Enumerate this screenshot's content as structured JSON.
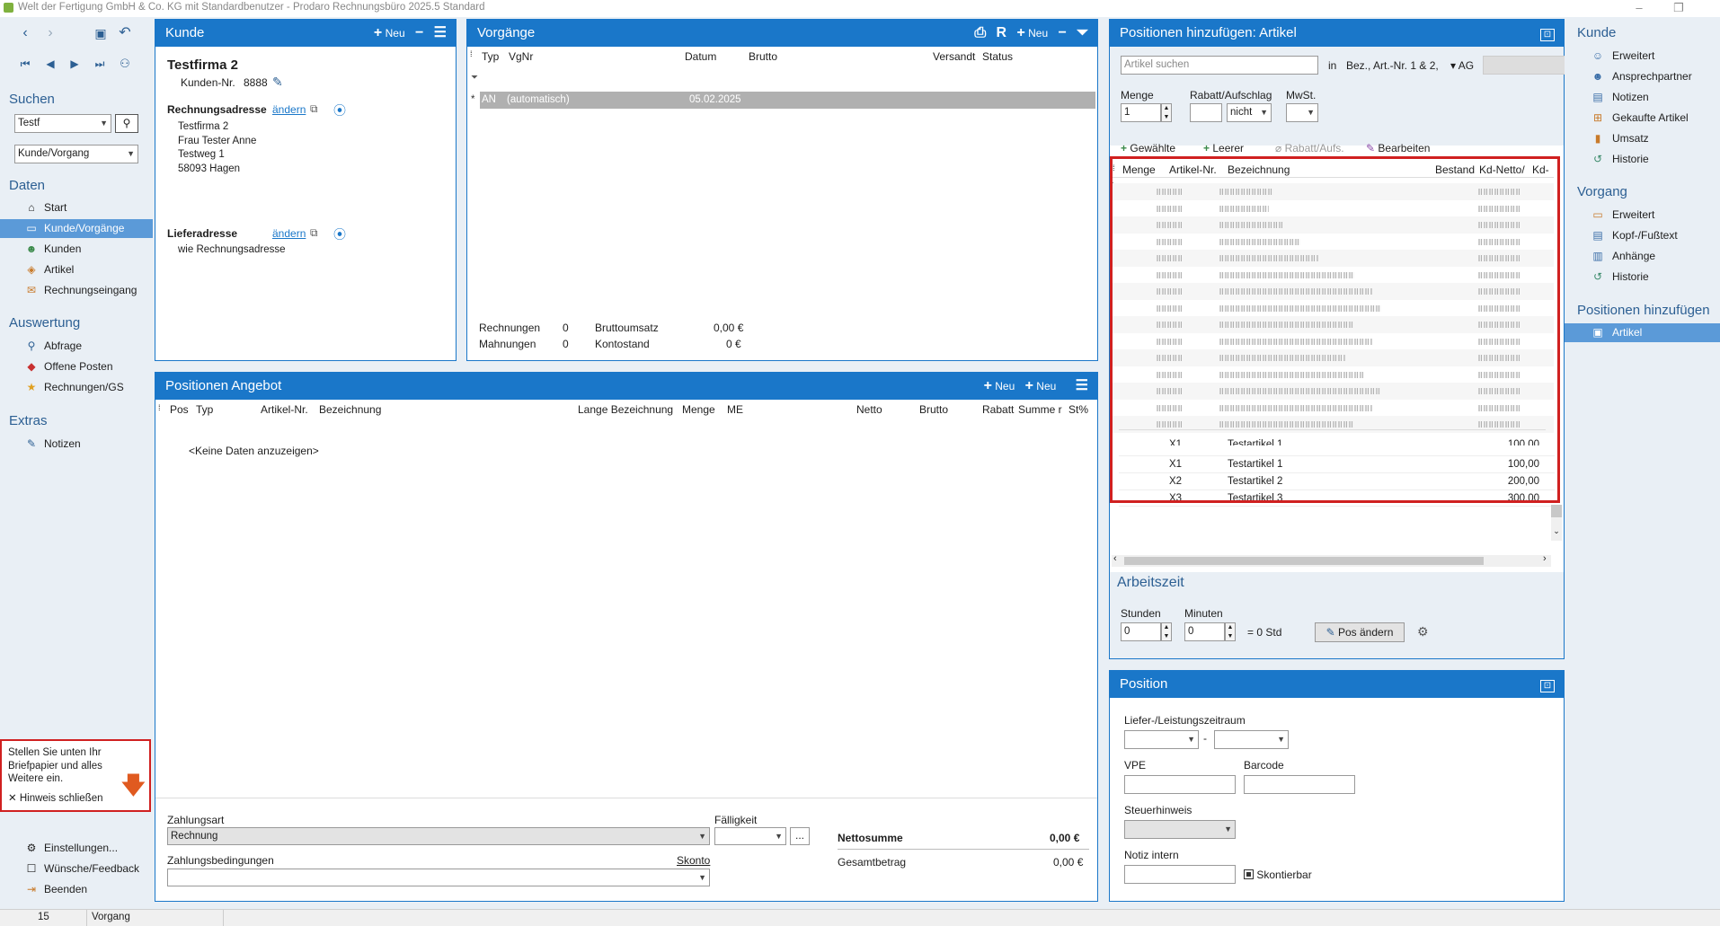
{
  "window": {
    "title": "Welt der Fertigung GmbH & Co. KG mit Standardbenutzer  -  Prodaro Rechnungsbüro 2025.5 Standard"
  },
  "sidebar": {
    "search_title": "Suchen",
    "search_value": "Testf",
    "search_mode": "Kunde/Vorgang",
    "daten_title": "Daten",
    "daten_items": [
      "Start",
      "Kunde/Vorgänge",
      "Kunden",
      "Artikel",
      "Rechnungseingang"
    ],
    "auswertung_title": "Auswertung",
    "auswertung_items": [
      "Abfrage",
      "Offene Posten",
      "Rechnungen/GS"
    ],
    "extras_title": "Extras",
    "extras_items": [
      "Notizen"
    ],
    "hint_text": "Stellen Sie unten Ihr Briefpapier und alles Weitere ein.",
    "hint_close": "Hinweis schließen",
    "bottom_items": [
      "Einstellungen...",
      "Wünsche/Feedback",
      "Beenden"
    ]
  },
  "kunde": {
    "title": "Kunde",
    "new_label": "Neu",
    "name": "Testfirma 2",
    "kunden_nr_label": "Kunden-Nr.",
    "kunden_nr": "8888",
    "rechnungsadresse_label": "Rechnungsadresse",
    "aendern": "ändern",
    "address": [
      "Testfirma 2",
      "Frau Tester Anne",
      "Testweg 1",
      "58093 Hagen"
    ],
    "lieferadresse_label": "Lieferadresse",
    "liefer_text": "wie Rechnungsadresse"
  },
  "vorgaenge": {
    "title": "Vorgänge",
    "new_label": "Neu",
    "r_label": "R",
    "columns": [
      "Typ",
      "VgNr",
      "Datum",
      "Brutto",
      "Versandt",
      "Status"
    ],
    "row": {
      "typ": "AN",
      "vgnr": "(automatisch)",
      "datum": "05.02.2025"
    },
    "rechnungen_label": "Rechnungen",
    "rechnungen": "0",
    "mahnungen_label": "Mahnungen",
    "mahnungen": "0",
    "bruttoumsatz_label": "Bruttoumsatz",
    "bruttoumsatz": "0,00 €",
    "kontostand_label": "Kontostand",
    "kontostand": "0 €"
  },
  "angebot": {
    "title": "Positionen Angebot",
    "new1": "Neu",
    "new2": "Neu",
    "columns": [
      "Pos",
      "Typ",
      "Artikel-Nr.",
      "Bezeichnung",
      "Lange Bezeichnung",
      "Menge",
      "ME",
      "Netto",
      "Brutto",
      "Rabatt",
      "Summe r",
      "St%"
    ],
    "empty": "<Keine Daten anzuzeigen>",
    "zahlungsart_label": "Zahlungsart",
    "zahlungsart": "Rechnung",
    "faelligkeit_label": "Fälligkeit",
    "zahlungsbed_label": "Zahlungsbedingungen",
    "skonto": "Skonto",
    "nettosumme_label": "Nettosumme",
    "nettosumme": "0,00  €",
    "gesamt_label": "Gesamtbetrag",
    "gesamt": "0,00  €"
  },
  "artikel": {
    "title": "Positionen hinzufügen: Artikel",
    "search_placeholder": "Artikel suchen",
    "in_label": "in",
    "in_value": "Bez., Art.-Nr. 1 & 2,",
    "ag_label": "AG",
    "menge_label": "Menge",
    "menge": "1",
    "rabatt_label": "Rabatt/Aufschlag",
    "rabatt_mode": "nicht",
    "mwst_label": "MwSt.",
    "btn_gewaehlte": "Gewählte",
    "btn_leerer": "Leerer",
    "btn_rabatt": "Rabatt/Aufs.",
    "btn_bearbeiten": "Bearbeiten",
    "columns": [
      "Menge",
      "Artikel-Nr.",
      "Bezeichnung",
      "Bestand",
      "Kd-Netto/",
      "Kd-"
    ],
    "rows": [
      {
        "nr": "X1",
        "bez": "Testartikel 1",
        "netto": "100,00"
      },
      {
        "nr": "X2",
        "bez": "Testartikel 2",
        "netto": "200,00"
      },
      {
        "nr": "X3",
        "bez": "Testartikel 3",
        "netto": "300,00"
      }
    ],
    "arbeitszeit_title": "Arbeitszeit",
    "stunden_label": "Stunden",
    "stunden": "0",
    "minuten_label": "Minuten",
    "minuten": "0",
    "std_text": "= 0 Std",
    "pos_aendern": "Pos ändern"
  },
  "position": {
    "title": "Position",
    "zeitraum_label": "Liefer-/Leistungszeitraum",
    "vpe_label": "VPE",
    "barcode_label": "Barcode",
    "steuer_label": "Steuerhinweis",
    "notiz_label": "Notiz intern",
    "skontierbar": "Skontierbar"
  },
  "right_nav": {
    "kunde_title": "Kunde",
    "kunde_items": [
      "Erweitert",
      "Ansprechpartner",
      "Notizen",
      "Gekaufte Artikel",
      "Umsatz",
      "Historie"
    ],
    "vorgang_title": "Vorgang",
    "vorgang_items": [
      "Erweitert",
      "Kopf-/Fußtext",
      "Anhänge",
      "Historie"
    ],
    "pos_title": "Positionen hinzufügen",
    "pos_items": [
      "Artikel"
    ]
  },
  "statusbar": {
    "count": "15",
    "context": "Vorgang"
  },
  "colors": {
    "accent": "#1a77c9",
    "selected_nav": "#5b9ad8",
    "highlight": "#d02020"
  }
}
